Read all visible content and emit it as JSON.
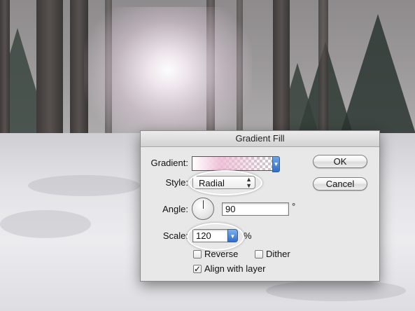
{
  "dialog": {
    "title": "Gradient Fill",
    "gradient_label": "Gradient:",
    "style_label": "Style:",
    "style_value": "Radial",
    "angle_label": "Angle:",
    "angle_value": "90",
    "angle_unit": "°",
    "scale_label": "Scale:",
    "scale_value": "120",
    "scale_unit": "%",
    "reverse_label": "Reverse",
    "reverse_checked": false,
    "dither_label": "Dither",
    "dither_checked": false,
    "align_label": "Align with layer",
    "align_checked": true,
    "align_check_mark": "✓",
    "ok_label": "OK",
    "cancel_label": "Cancel"
  },
  "icons": {
    "gradient_dropdown": "triangle-down-icon",
    "style_stepper": "up-down-arrows-icon",
    "angle_dial": "angle-dial-icon",
    "scale_dropdown": "triangle-down-icon"
  },
  "colors": {
    "accent_blue": "#2f6fc9",
    "dialog_bg": "#e8e8e8",
    "gradient_pink": "#f0bed7"
  }
}
